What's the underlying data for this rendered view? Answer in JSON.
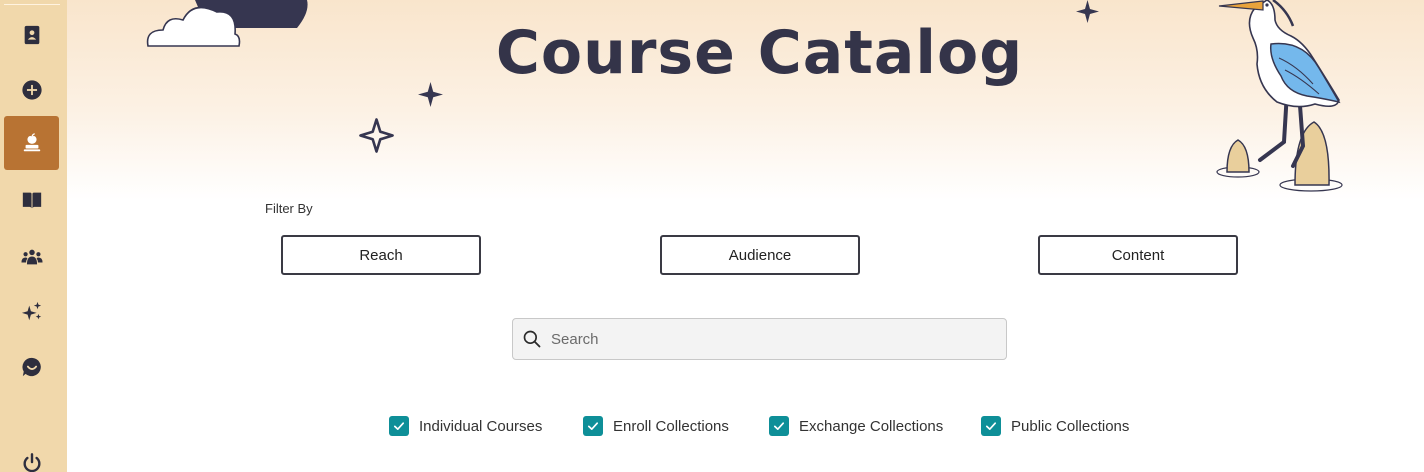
{
  "sidebar": {
    "items": [
      {
        "icon": "contacts-book-icon",
        "active": false
      },
      {
        "icon": "plus-circle-icon",
        "active": false
      },
      {
        "icon": "teacher-apple-icon",
        "active": true
      },
      {
        "icon": "open-book-icon",
        "active": false
      },
      {
        "icon": "users-group-icon",
        "active": false
      },
      {
        "icon": "sparkles-icon",
        "active": false
      },
      {
        "icon": "chat-smile-icon",
        "active": false
      },
      {
        "icon": "power-icon",
        "active": false
      }
    ]
  },
  "header": {
    "title": "Course Catalog"
  },
  "filters": {
    "label": "Filter By",
    "buttons": [
      "Reach",
      "Audience",
      "Content"
    ]
  },
  "search": {
    "placeholder": "Search",
    "value": ""
  },
  "checkboxes": [
    {
      "label": "Individual Courses",
      "checked": true
    },
    {
      "label": "Enroll Collections",
      "checked": true
    },
    {
      "label": "Exchange Collections",
      "checked": true
    },
    {
      "label": "Public Collections",
      "checked": true
    }
  ],
  "colors": {
    "sidebar_bg": "#f1d8ab",
    "active_nav": "#b87333",
    "title": "#343449",
    "checkbox": "#0e8f98"
  }
}
